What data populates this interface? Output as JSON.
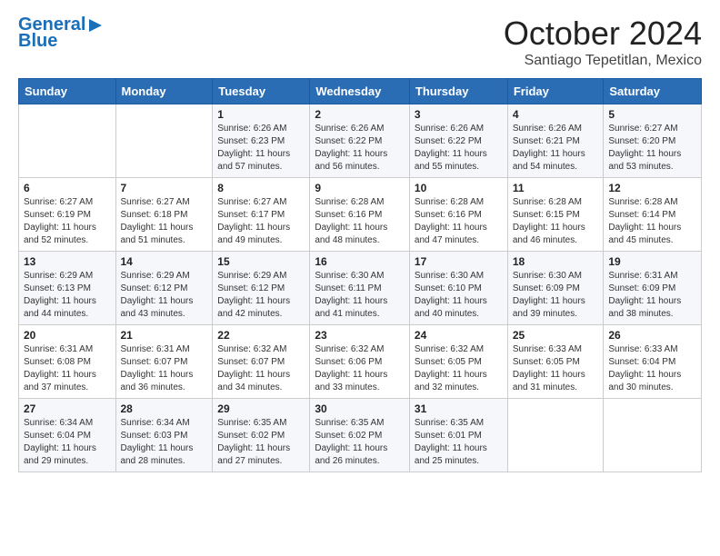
{
  "header": {
    "logo_line1": "General",
    "logo_line2": "Blue",
    "month": "October 2024",
    "location": "Santiago Tepetitlan, Mexico"
  },
  "weekdays": [
    "Sunday",
    "Monday",
    "Tuesday",
    "Wednesday",
    "Thursday",
    "Friday",
    "Saturday"
  ],
  "weeks": [
    [
      {
        "day": "",
        "info": ""
      },
      {
        "day": "",
        "info": ""
      },
      {
        "day": "1",
        "info": "Sunrise: 6:26 AM\nSunset: 6:23 PM\nDaylight: 11 hours\nand 57 minutes."
      },
      {
        "day": "2",
        "info": "Sunrise: 6:26 AM\nSunset: 6:22 PM\nDaylight: 11 hours\nand 56 minutes."
      },
      {
        "day": "3",
        "info": "Sunrise: 6:26 AM\nSunset: 6:22 PM\nDaylight: 11 hours\nand 55 minutes."
      },
      {
        "day": "4",
        "info": "Sunrise: 6:26 AM\nSunset: 6:21 PM\nDaylight: 11 hours\nand 54 minutes."
      },
      {
        "day": "5",
        "info": "Sunrise: 6:27 AM\nSunset: 6:20 PM\nDaylight: 11 hours\nand 53 minutes."
      }
    ],
    [
      {
        "day": "6",
        "info": "Sunrise: 6:27 AM\nSunset: 6:19 PM\nDaylight: 11 hours\nand 52 minutes."
      },
      {
        "day": "7",
        "info": "Sunrise: 6:27 AM\nSunset: 6:18 PM\nDaylight: 11 hours\nand 51 minutes."
      },
      {
        "day": "8",
        "info": "Sunrise: 6:27 AM\nSunset: 6:17 PM\nDaylight: 11 hours\nand 49 minutes."
      },
      {
        "day": "9",
        "info": "Sunrise: 6:28 AM\nSunset: 6:16 PM\nDaylight: 11 hours\nand 48 minutes."
      },
      {
        "day": "10",
        "info": "Sunrise: 6:28 AM\nSunset: 6:16 PM\nDaylight: 11 hours\nand 47 minutes."
      },
      {
        "day": "11",
        "info": "Sunrise: 6:28 AM\nSunset: 6:15 PM\nDaylight: 11 hours\nand 46 minutes."
      },
      {
        "day": "12",
        "info": "Sunrise: 6:28 AM\nSunset: 6:14 PM\nDaylight: 11 hours\nand 45 minutes."
      }
    ],
    [
      {
        "day": "13",
        "info": "Sunrise: 6:29 AM\nSunset: 6:13 PM\nDaylight: 11 hours\nand 44 minutes."
      },
      {
        "day": "14",
        "info": "Sunrise: 6:29 AM\nSunset: 6:12 PM\nDaylight: 11 hours\nand 43 minutes."
      },
      {
        "day": "15",
        "info": "Sunrise: 6:29 AM\nSunset: 6:12 PM\nDaylight: 11 hours\nand 42 minutes."
      },
      {
        "day": "16",
        "info": "Sunrise: 6:30 AM\nSunset: 6:11 PM\nDaylight: 11 hours\nand 41 minutes."
      },
      {
        "day": "17",
        "info": "Sunrise: 6:30 AM\nSunset: 6:10 PM\nDaylight: 11 hours\nand 40 minutes."
      },
      {
        "day": "18",
        "info": "Sunrise: 6:30 AM\nSunset: 6:09 PM\nDaylight: 11 hours\nand 39 minutes."
      },
      {
        "day": "19",
        "info": "Sunrise: 6:31 AM\nSunset: 6:09 PM\nDaylight: 11 hours\nand 38 minutes."
      }
    ],
    [
      {
        "day": "20",
        "info": "Sunrise: 6:31 AM\nSunset: 6:08 PM\nDaylight: 11 hours\nand 37 minutes."
      },
      {
        "day": "21",
        "info": "Sunrise: 6:31 AM\nSunset: 6:07 PM\nDaylight: 11 hours\nand 36 minutes."
      },
      {
        "day": "22",
        "info": "Sunrise: 6:32 AM\nSunset: 6:07 PM\nDaylight: 11 hours\nand 34 minutes."
      },
      {
        "day": "23",
        "info": "Sunrise: 6:32 AM\nSunset: 6:06 PM\nDaylight: 11 hours\nand 33 minutes."
      },
      {
        "day": "24",
        "info": "Sunrise: 6:32 AM\nSunset: 6:05 PM\nDaylight: 11 hours\nand 32 minutes."
      },
      {
        "day": "25",
        "info": "Sunrise: 6:33 AM\nSunset: 6:05 PM\nDaylight: 11 hours\nand 31 minutes."
      },
      {
        "day": "26",
        "info": "Sunrise: 6:33 AM\nSunset: 6:04 PM\nDaylight: 11 hours\nand 30 minutes."
      }
    ],
    [
      {
        "day": "27",
        "info": "Sunrise: 6:34 AM\nSunset: 6:04 PM\nDaylight: 11 hours\nand 29 minutes."
      },
      {
        "day": "28",
        "info": "Sunrise: 6:34 AM\nSunset: 6:03 PM\nDaylight: 11 hours\nand 28 minutes."
      },
      {
        "day": "29",
        "info": "Sunrise: 6:35 AM\nSunset: 6:02 PM\nDaylight: 11 hours\nand 27 minutes."
      },
      {
        "day": "30",
        "info": "Sunrise: 6:35 AM\nSunset: 6:02 PM\nDaylight: 11 hours\nand 26 minutes."
      },
      {
        "day": "31",
        "info": "Sunrise: 6:35 AM\nSunset: 6:01 PM\nDaylight: 11 hours\nand 25 minutes."
      },
      {
        "day": "",
        "info": ""
      },
      {
        "day": "",
        "info": ""
      }
    ]
  ]
}
